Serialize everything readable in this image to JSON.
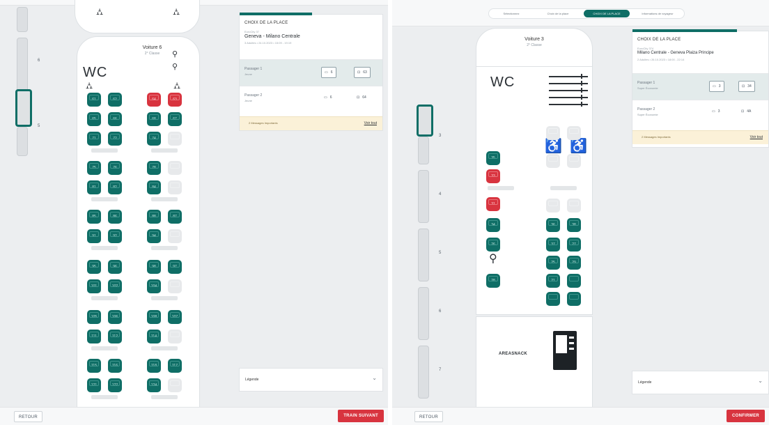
{
  "left": {
    "car": {
      "title": "Voiture 6",
      "class": "2° Classe"
    },
    "minimap_numbers": [
      "6",
      "5"
    ],
    "wc": "WC",
    "seats": {
      "row1": [
        "61",
        "62",
        "64",
        "63"
      ],
      "row2": [
        "65",
        "66",
        "68",
        "67"
      ],
      "row3": [
        "71",
        "72",
        "74",
        ""
      ],
      "row4": [
        "75",
        "76",
        "78",
        ""
      ],
      "row5": [
        "81",
        "82",
        "84",
        ""
      ],
      "row6": [
        "85",
        "86",
        "88",
        "87"
      ],
      "row7": [
        "91",
        "92",
        "94",
        ""
      ],
      "row8": [
        "95",
        "96",
        "98",
        "97"
      ],
      "row9": [
        "101",
        "102",
        "104",
        ""
      ],
      "row10": [
        "105",
        "106",
        "108",
        "107"
      ],
      "row11": [
        "111",
        "112",
        "114",
        ""
      ],
      "row12": [
        "115",
        "116",
        "118",
        "117"
      ],
      "row13": [
        "121",
        "122",
        "124",
        ""
      ]
    },
    "card": {
      "title": "CHOIX DE LA PLACE",
      "label": "EuroCity 37",
      "route": "Geneva - Milano Centrale",
      "meta": "3 Adultes • 24.10.2023 • 15:09 - 19:19"
    },
    "passengers": [
      {
        "name": "Passager 1",
        "type": "Jeune",
        "car": "6",
        "seat": "63"
      },
      {
        "name": "Passager 2",
        "type": "Jeune",
        "car": "6",
        "seat": "64"
      }
    ],
    "message": {
      "text": "2 Messages Importants",
      "link": "Voir tout"
    },
    "legend": "Légende",
    "back": "RETOUR",
    "next": "TRAIN SUIVANT"
  },
  "right": {
    "tabs": [
      "Sélectionnez",
      "Choix de la place",
      "CHOIX DE LA PLACE",
      "Informations de voyageur"
    ],
    "car": {
      "title": "Voiture 3",
      "class": "2° Classe"
    },
    "minimap_numbers": [
      "3",
      "4",
      "5",
      "6",
      "7"
    ],
    "wc": "WC",
    "accessible_seats": [
      "",
      ""
    ],
    "seats_left": [
      "35",
      "33",
      "31",
      "34",
      "26",
      "28"
    ],
    "seats_right": [
      "36",
      "38",
      "37",
      "27",
      "25",
      "29",
      "21"
    ],
    "snack_label": "AREASNACK",
    "card": {
      "title": "CHOIX DE LA PLACE",
      "label": "EuroCity 374",
      "route": "Milano Centrale - Geneva Plaiza Principe",
      "meta": "2 Adultes • 26.10.2023 • 18:00 - 22:14"
    },
    "passengers": [
      {
        "name": "Passager 1",
        "type": "Super Économie",
        "car": "3",
        "seat": "34"
      },
      {
        "name": "Passager 2",
        "type": "Super Économie",
        "car": "3",
        "seat": "4A"
      }
    ],
    "message": {
      "text": "2 Messages Importants",
      "link": "Voir tout"
    },
    "legend": "Légende",
    "back": "RETOUR",
    "confirm": "CONFIRMER"
  },
  "colors": {
    "accent": "#0f6e66",
    "danger": "#d8343f",
    "warning_bg": "#fbf1d8"
  },
  "icons": {
    "luggage": "luggage-icon",
    "bike": "bike-icon",
    "wheelchair": "wheelchair-icon",
    "seat": "seat-icon",
    "snack": "vending-machine-icon"
  }
}
